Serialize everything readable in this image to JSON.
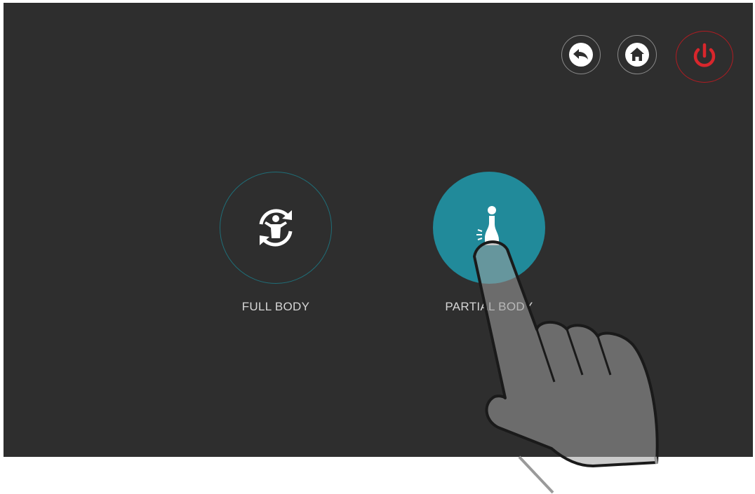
{
  "toolbar": {
    "back_icon": "back-arrow-icon",
    "home_icon": "home-icon",
    "power_icon": "power-icon"
  },
  "modes": [
    {
      "label": "FULL BODY",
      "icon": "full-body-rotation-icon",
      "selected": false
    },
    {
      "label": "PARTIAL BODY",
      "icon": "partial-body-icon",
      "selected": true
    }
  ],
  "colors": {
    "background": "#2e2e2e",
    "accent": "#218a9a",
    "power": "#d8262c",
    "text": "#d6d6d6"
  }
}
